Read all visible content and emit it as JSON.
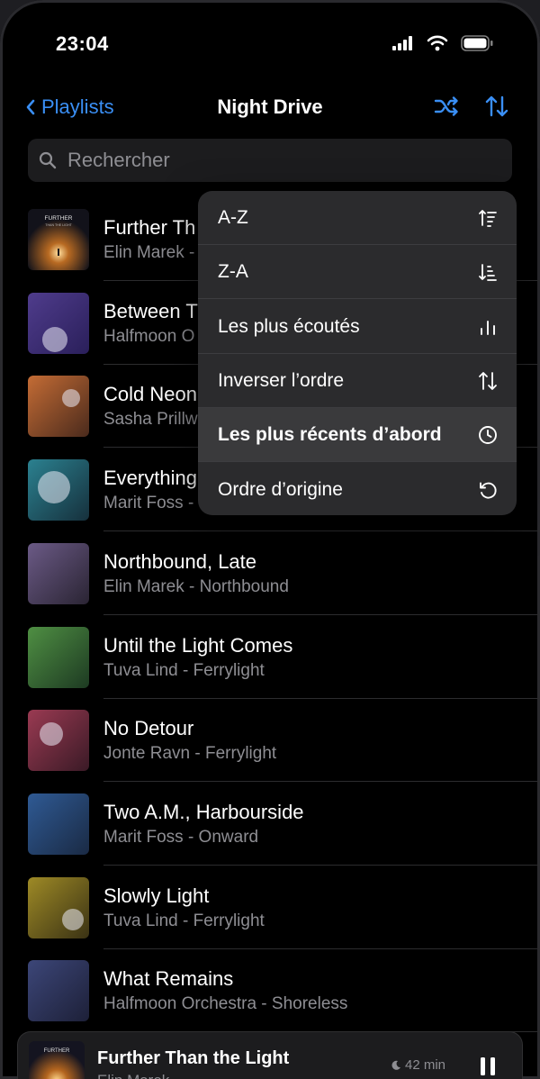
{
  "status_bar": {
    "time": "23:04"
  },
  "nav": {
    "back_label": "Playlists",
    "title": "Night Drive"
  },
  "search": {
    "placeholder": "Rechercher"
  },
  "tracks": [
    {
      "title": "Further Th",
      "subtitle": "Elin Marek -",
      "art_colors": [
        "#1a1b24",
        "#3b2a1a"
      ]
    },
    {
      "title": "Between T",
      "subtitle": "Halfmoon O",
      "art_colors": [
        "#4f3c8c",
        "#2a1f5a"
      ]
    },
    {
      "title": "Cold Neon",
      "subtitle": "Sasha Prillw",
      "art_colors": [
        "#c46c35",
        "#4a2a1c"
      ]
    },
    {
      "title": "Everything",
      "subtitle": "Marit Foss -",
      "art_colors": [
        "#2b8190",
        "#16303c"
      ]
    },
    {
      "title": "Northbound, Late",
      "subtitle": "Elin Marek - Northbound",
      "art_colors": [
        "#6b5a86",
        "#2a2433"
      ]
    },
    {
      "title": "Until the Light Comes",
      "subtitle": "Tuva Lind - Ferrylight",
      "art_colors": [
        "#4f8f43",
        "#1d3a22"
      ]
    },
    {
      "title": "No Detour",
      "subtitle": "Jonte Ravn - Ferrylight",
      "art_colors": [
        "#9a3a52",
        "#3a1a26"
      ]
    },
    {
      "title": "Two A.M., Harbourside",
      "subtitle": "Marit Foss - Onward",
      "art_colors": [
        "#2f5a94",
        "#1a2a44"
      ]
    },
    {
      "title": "Slowly Light",
      "subtitle": "Tuva Lind - Ferrylight",
      "art_colors": [
        "#9e8a26",
        "#3a3214"
      ]
    },
    {
      "title": "What Remains",
      "subtitle": "Halfmoon Orchestra - Shoreless",
      "art_colors": [
        "#3c4678",
        "#1d2038"
      ]
    }
  ],
  "sort_menu": {
    "items": [
      {
        "label": "A-Z",
        "icon": "sort-ascending-icon"
      },
      {
        "label": "Z-A",
        "icon": "sort-descending-icon"
      },
      {
        "label": "Les plus écoutés",
        "icon": "bar-chart-icon"
      },
      {
        "label": "Inverser l’ordre",
        "icon": "reverse-order-icon"
      },
      {
        "label": "Les plus récents d’abord",
        "icon": "clock-icon",
        "selected": true
      },
      {
        "label": "Ordre d’origine",
        "icon": "undo-icon"
      }
    ]
  },
  "art_text": {
    "line1": "FURTHER",
    "line2": "THAN THE LIGHT"
  },
  "now_playing": {
    "title": "Further Than the Light",
    "subtitle": "Elin Marek",
    "timer": "42 min"
  },
  "colors": {
    "accent": "#3a8ff5",
    "background": "#000000",
    "menu": "#2b2b2d"
  }
}
